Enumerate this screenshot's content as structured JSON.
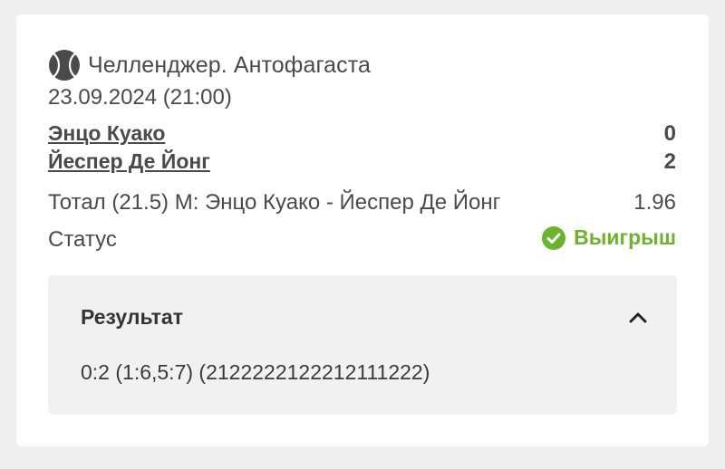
{
  "event": {
    "sport_icon": "tennis-ball-icon",
    "tournament": "Челленджер. Антофагаста",
    "datetime": "23.09.2024 (21:00)"
  },
  "teams": [
    {
      "name": "Энцо Куако",
      "score": "0"
    },
    {
      "name": "Йеспер Де Йонг",
      "score": "2"
    }
  ],
  "bet": {
    "description": "Тотал (21.5) М: Энцо Куако - Йеспер Де Йонг",
    "odds": "1.96"
  },
  "status": {
    "label": "Статус",
    "value": "Выигрыш",
    "icon": "check-circle-icon",
    "color": "#6bb42c"
  },
  "result": {
    "title": "Результат",
    "value": "0:2 (1:6,5:7) (2122222122212111222)",
    "toggle_icon": "chevron-up-icon"
  }
}
